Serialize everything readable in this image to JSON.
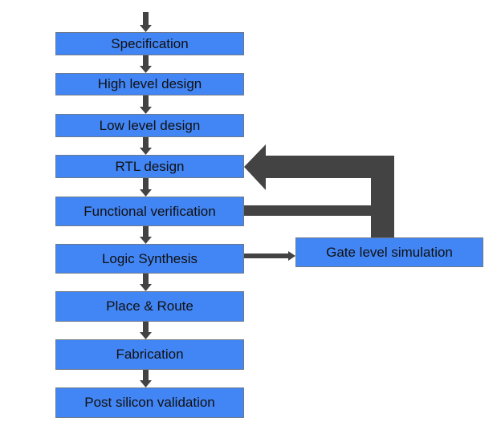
{
  "diagram": {
    "title": "",
    "colors": {
      "box_fill": "#4285f4",
      "arrow": "#434343",
      "text": "#111111"
    },
    "flow_steps": [
      "Specification",
      "High level design",
      "Low level design",
      "RTL design",
      "Functional verification",
      "Logic Synthesis",
      "Place & Route",
      "Fabrication",
      "Post silicon validation"
    ],
    "side_step": "Gate level simulation",
    "edges": [
      {
        "from": "start",
        "to": "Specification"
      },
      {
        "from": "Specification",
        "to": "High level design"
      },
      {
        "from": "High level design",
        "to": "Low level design"
      },
      {
        "from": "Low level design",
        "to": "RTL design"
      },
      {
        "from": "RTL design",
        "to": "Functional verification"
      },
      {
        "from": "Functional verification",
        "to": "Logic Synthesis"
      },
      {
        "from": "Logic Synthesis",
        "to": "Place & Route"
      },
      {
        "from": "Place & Route",
        "to": "Fabrication"
      },
      {
        "from": "Fabrication",
        "to": "Post silicon validation"
      },
      {
        "from": "Logic Synthesis",
        "to": "Gate level simulation"
      },
      {
        "from": "Gate level simulation",
        "to": "RTL design",
        "style": "feedback"
      },
      {
        "from": "Functional verification",
        "to": "RTL design",
        "style": "feedback"
      }
    ]
  }
}
